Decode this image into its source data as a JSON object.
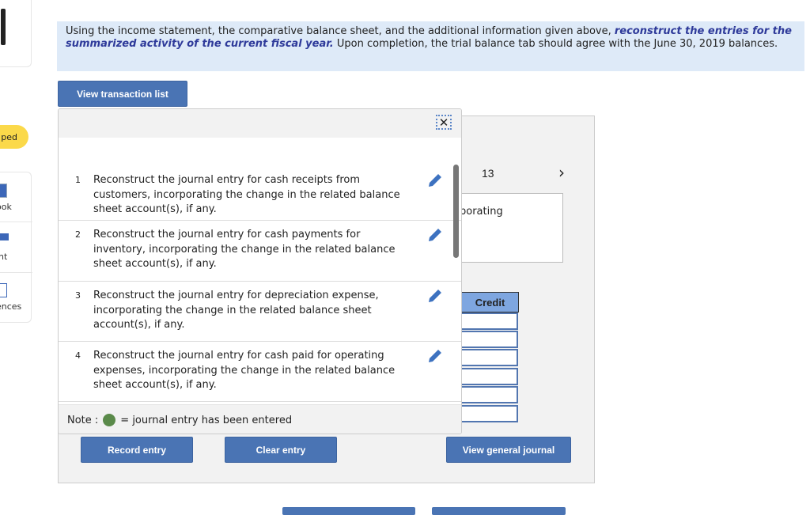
{
  "sidebar": {
    "status_badge": "ped",
    "items": [
      {
        "label": "ook",
        "icon": "book-icon"
      },
      {
        "label": "int",
        "icon": "print-icon"
      },
      {
        "label": "ences",
        "icon": "references-icon"
      }
    ]
  },
  "instructions": {
    "text_before": "Using the income statement, the comparative balance sheet, and the additional information given above, ",
    "emphasis": "reconstruct the entries for the summarized activity of the current fiscal year.",
    "text_after": " Upon completion, the trial balance tab should agree with the June 30, 2019 balances."
  },
  "view_transaction_list_label": "View transaction list",
  "background_panel": {
    "page_number": "13",
    "next_icon": "chevron-right-icon",
    "partial_text": "porating",
    "credit_header": "Credit",
    "view_general_journal_label": "View general journal"
  },
  "popup": {
    "close_icon": "close-icon",
    "transactions": [
      {
        "num": "1",
        "text": "Reconstruct the journal entry for cash receipts from customers, incorporating the change in the related balance sheet account(s), if any."
      },
      {
        "num": "2",
        "text": "Reconstruct the journal entry for cash payments for inventory, incorporating the change in the related balance sheet account(s), if any."
      },
      {
        "num": "3",
        "text": "Reconstruct the journal entry for depreciation expense, incorporating the change in the related balance sheet account(s), if any."
      },
      {
        "num": "4",
        "text": "Reconstruct the journal entry for cash paid for operating expenses, incorporating the change in the related balance sheet account(s), if any."
      }
    ],
    "note_label": "Note :",
    "note_text": "= journal entry has been entered",
    "note_color": "#5a8a4a"
  },
  "record_entry_label": "Record entry",
  "clear_entry_label": "Clear entry",
  "colors": {
    "accent": "#4a74b4",
    "banner": "#deeaf8",
    "emphasis": "#2e3a9a",
    "badge": "#fbd94a"
  }
}
